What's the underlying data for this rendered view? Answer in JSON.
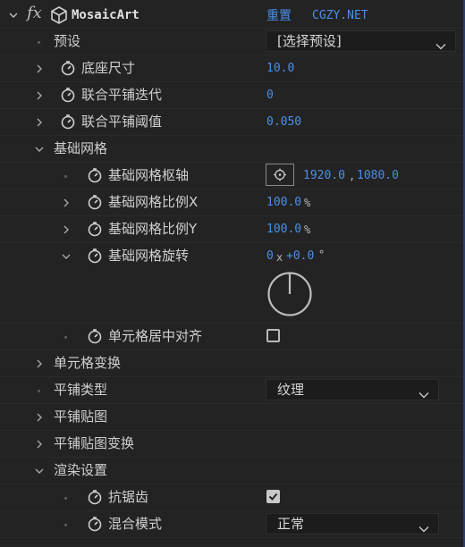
{
  "effect": {
    "fx_label": "fx",
    "name": "MosaicArt",
    "reset_label": "重置",
    "site_label": "CGZY.NET"
  },
  "preset": {
    "label": "预设",
    "value": "[选择预设]"
  },
  "base_size": {
    "label": "底座尺寸",
    "value": "10.0"
  },
  "union_iter": {
    "label": "联合平铺迭代",
    "value": "0"
  },
  "union_threshold": {
    "label": "联合平铺阈值",
    "value": "0.050"
  },
  "base_grid": {
    "label": "基础网格",
    "pivot": {
      "label": "基础网格枢轴",
      "x": "1920.0",
      "sep": ",",
      "y": "1080.0"
    },
    "scale_x": {
      "label": "基础网格比例X",
      "value": "100.0",
      "unit": "%"
    },
    "scale_y": {
      "label": "基础网格比例Y",
      "value": "100.0",
      "unit": "%"
    },
    "rotation": {
      "label": "基础网格旋转",
      "turns": "0",
      "x": "x",
      "degrees": "+0.0",
      "deg": "°",
      "angle": 0
    },
    "center_align": {
      "label": "单元格居中对齐",
      "checked": false
    }
  },
  "cell_transform": {
    "label": "单元格变换"
  },
  "tile_type": {
    "label": "平铺类型",
    "value": "纹理"
  },
  "tile_map": {
    "label": "平铺贴图"
  },
  "tile_map_transform": {
    "label": "平铺贴图变换"
  },
  "render": {
    "label": "渲染设置",
    "antialias": {
      "label": "抗锯齿",
      "checked": true
    },
    "blend_mode": {
      "label": "混合模式",
      "value": "正常"
    }
  }
}
